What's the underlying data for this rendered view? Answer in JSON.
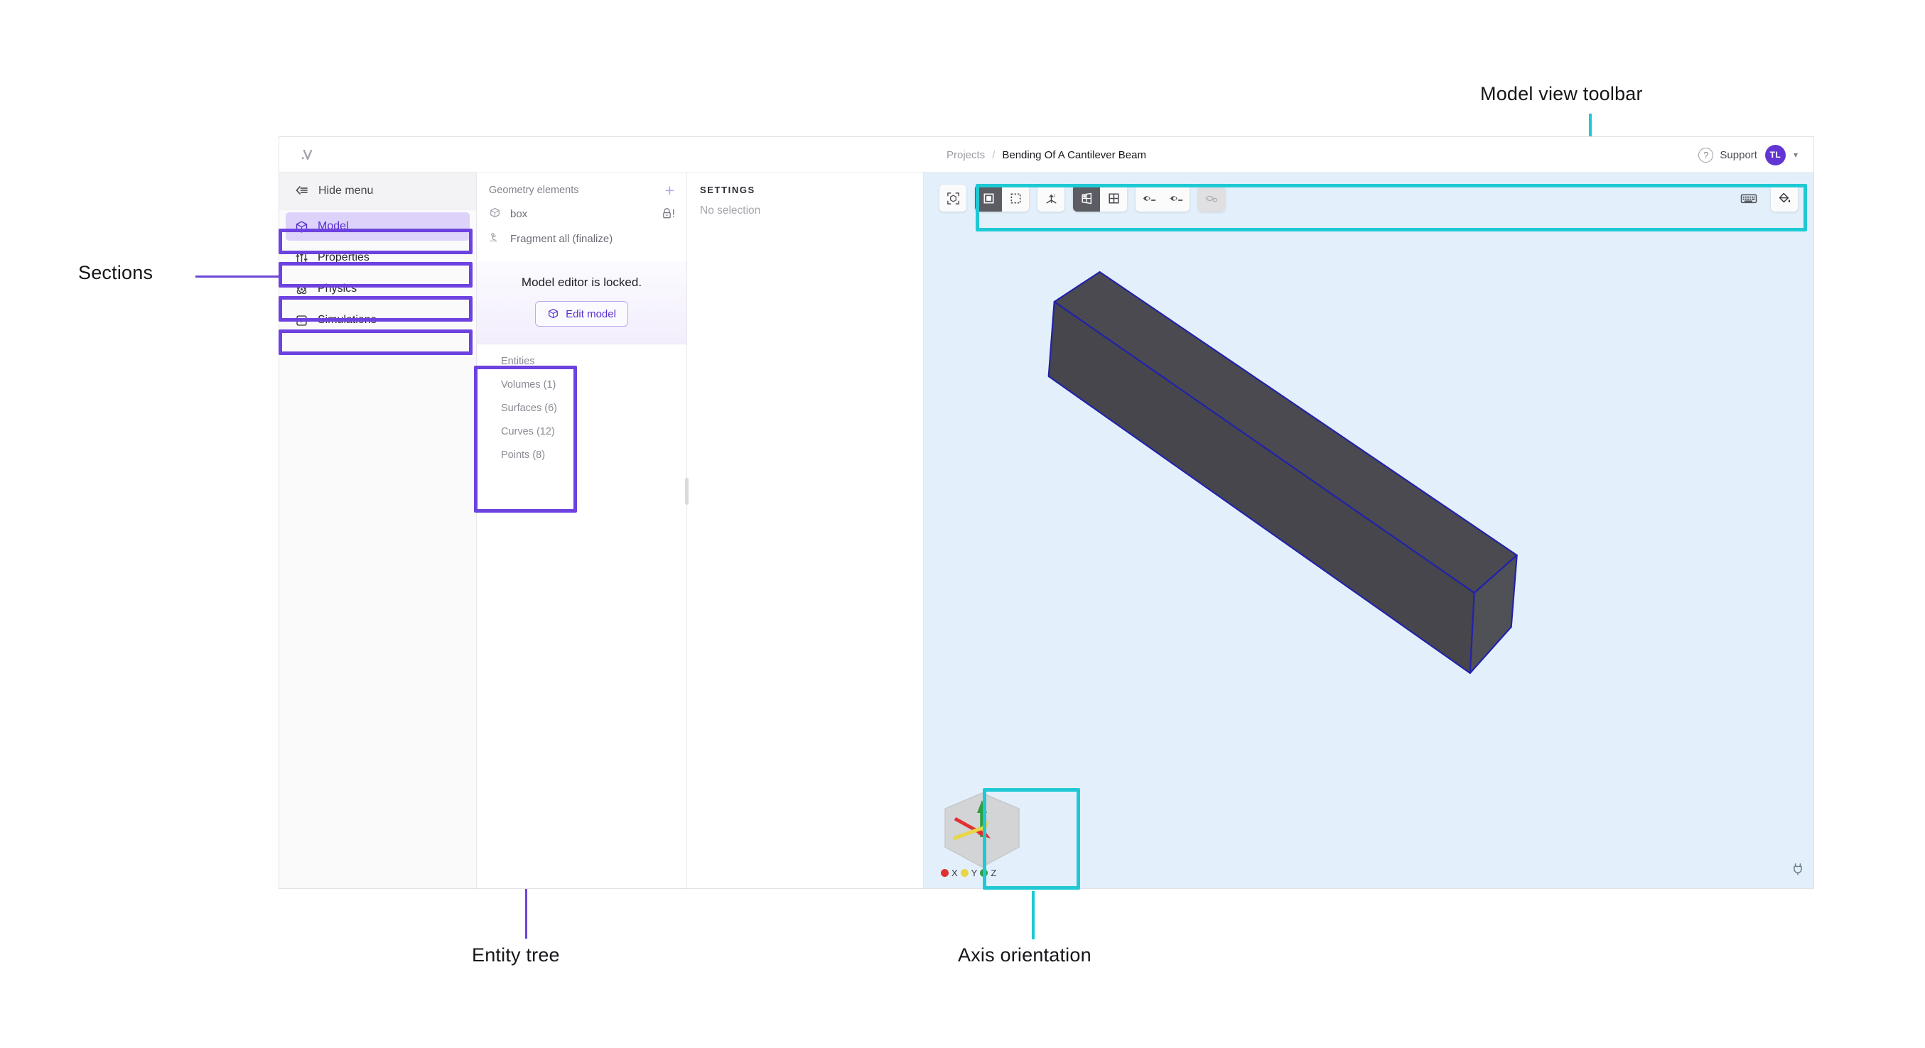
{
  "annotations": [
    {
      "id": "model-view-toolbar",
      "text": "Model view toolbar"
    },
    {
      "id": "sections",
      "text": "Sections"
    },
    {
      "id": "entity-tree",
      "text": "Entity tree"
    },
    {
      "id": "axis-orientation",
      "text": "Axis orientation"
    }
  ],
  "colors": {
    "highlight_purple": "#6d42e0",
    "highlight_cyan": "#1fc9d4",
    "accent": "#5a2fd0",
    "viewport_bg": "#e3f0fb",
    "beam_face": "#4a4a50",
    "beam_edge": "#2222aa",
    "avatar_bg": "#6336d4"
  },
  "topbar": {
    "logo": "logo-icon",
    "breadcrumb": {
      "root": "Projects",
      "separator": "/",
      "current": "Bending Of A Cantilever Beam"
    },
    "support_label": "Support",
    "support_icon": "question-circle-icon",
    "avatar_initials": "TL",
    "avatar_chevron": "chevron-down-icon"
  },
  "sidebar": {
    "hide_menu_label": "Hide menu",
    "hide_menu_icon": "collapse-left-icon",
    "items": [
      {
        "label": "Model",
        "icon": "cube-icon",
        "active": true
      },
      {
        "label": "Properties",
        "icon": "sliders-icon",
        "active": false
      },
      {
        "label": "Physics",
        "icon": "atom-icon",
        "active": false
      },
      {
        "label": "Simulations",
        "icon": "play-box-icon",
        "active": false
      }
    ]
  },
  "geometry": {
    "title": "Geometry elements",
    "add_icon": "plus-icon",
    "rows": [
      {
        "label": "box",
        "icon": "cube-outline-icon",
        "badge": "lock-icon",
        "badge_suffix": "!"
      },
      {
        "label": "Fragment all (finalize)",
        "icon": "fragment-icon",
        "badge": ""
      }
    ],
    "locked": {
      "message": "Model editor is locked.",
      "button_label": "Edit model",
      "button_icon": "cube-icon"
    },
    "entity_tree": [
      "Entities",
      "Volumes (1)",
      "Surfaces (6)",
      "Curves (12)",
      "Points (8)"
    ]
  },
  "settings": {
    "title": "SETTINGS",
    "empty_text": "No selection"
  },
  "viewport": {
    "toolbar": {
      "groups": [
        {
          "buttons": [
            {
              "icon": "fit-to-view-icon",
              "state": "normal"
            }
          ]
        },
        {
          "buttons": [
            {
              "icon": "solid-select-icon",
              "state": "active"
            },
            {
              "icon": "dashed-select-icon",
              "state": "normal"
            }
          ]
        },
        {
          "buttons": [
            {
              "icon": "axes-icon",
              "state": "normal"
            }
          ]
        },
        {
          "buttons": [
            {
              "icon": "perspective-view-icon",
              "state": "active"
            },
            {
              "icon": "grid-view-icon",
              "state": "normal"
            }
          ]
        },
        {
          "buttons": [
            {
              "icon": "eye-minus-icon",
              "state": "normal"
            },
            {
              "icon": "eye-dash-icon",
              "state": "normal"
            }
          ]
        },
        {
          "buttons": [
            {
              "icon": "eye-off-icon",
              "state": "disabled"
            }
          ]
        }
      ],
      "right_buttons": [
        {
          "icon": "keyboard-icon",
          "state": "plain"
        },
        {
          "icon": "paint-bucket-icon",
          "state": "normal"
        }
      ]
    },
    "axis_widget": {
      "axes": [
        {
          "label": "X",
          "color": "#e03131"
        },
        {
          "label": "Y",
          "color": "#e8d644"
        },
        {
          "label": "Z",
          "color": "#2f9e3f"
        }
      ]
    },
    "status_icon": "plug-icon"
  }
}
